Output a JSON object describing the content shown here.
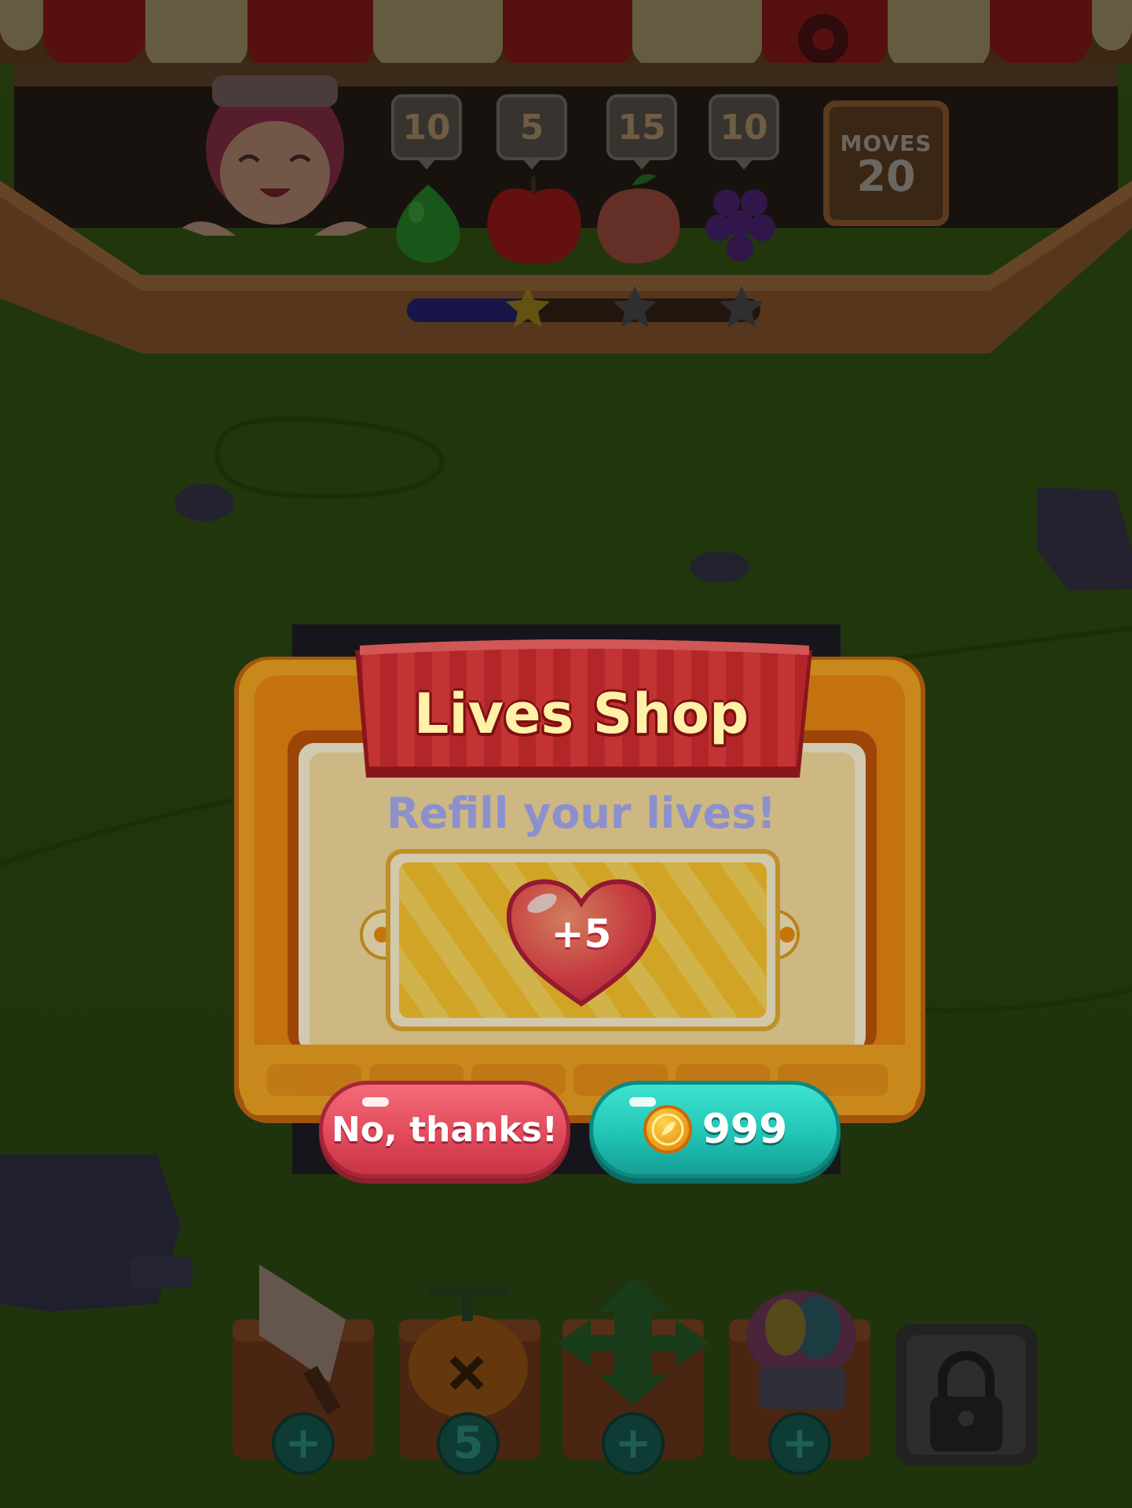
{
  "hud": {
    "goals": [
      {
        "fruit": "pear",
        "count": "10"
      },
      {
        "fruit": "apple",
        "count": "5"
      },
      {
        "fruit": "peach",
        "count": "15"
      },
      {
        "fruit": "grape",
        "count": "10"
      }
    ],
    "moves": {
      "label": "MOVES",
      "value": "20"
    },
    "stars_earned": 1,
    "stars_total": 3,
    "settings_icon": "gear-icon"
  },
  "dialog": {
    "title": "Lives Shop",
    "subtitle": "Refill your lives!",
    "offer": {
      "icon": "heart-icon",
      "amount": "+5"
    },
    "buttons": {
      "decline": "No, thanks!",
      "buy_price": "999",
      "currency_icon": "coin-icon"
    }
  },
  "boosters": [
    {
      "name": "carrot-hammer",
      "badge": "+"
    },
    {
      "name": "pumpkin-bomb",
      "badge": "5"
    },
    {
      "name": "arrow-cross",
      "badge": "+"
    },
    {
      "name": "rainbow-icecream",
      "badge": "+"
    },
    {
      "name": "locked-slot",
      "badge": ""
    }
  ],
  "colors": {
    "banner_red": "#e53a3a",
    "panel_orange": "#f6a623",
    "decline_red": "#e14b5b",
    "buy_teal": "#22c4b6",
    "subtitle_purple": "#8c90cc"
  }
}
